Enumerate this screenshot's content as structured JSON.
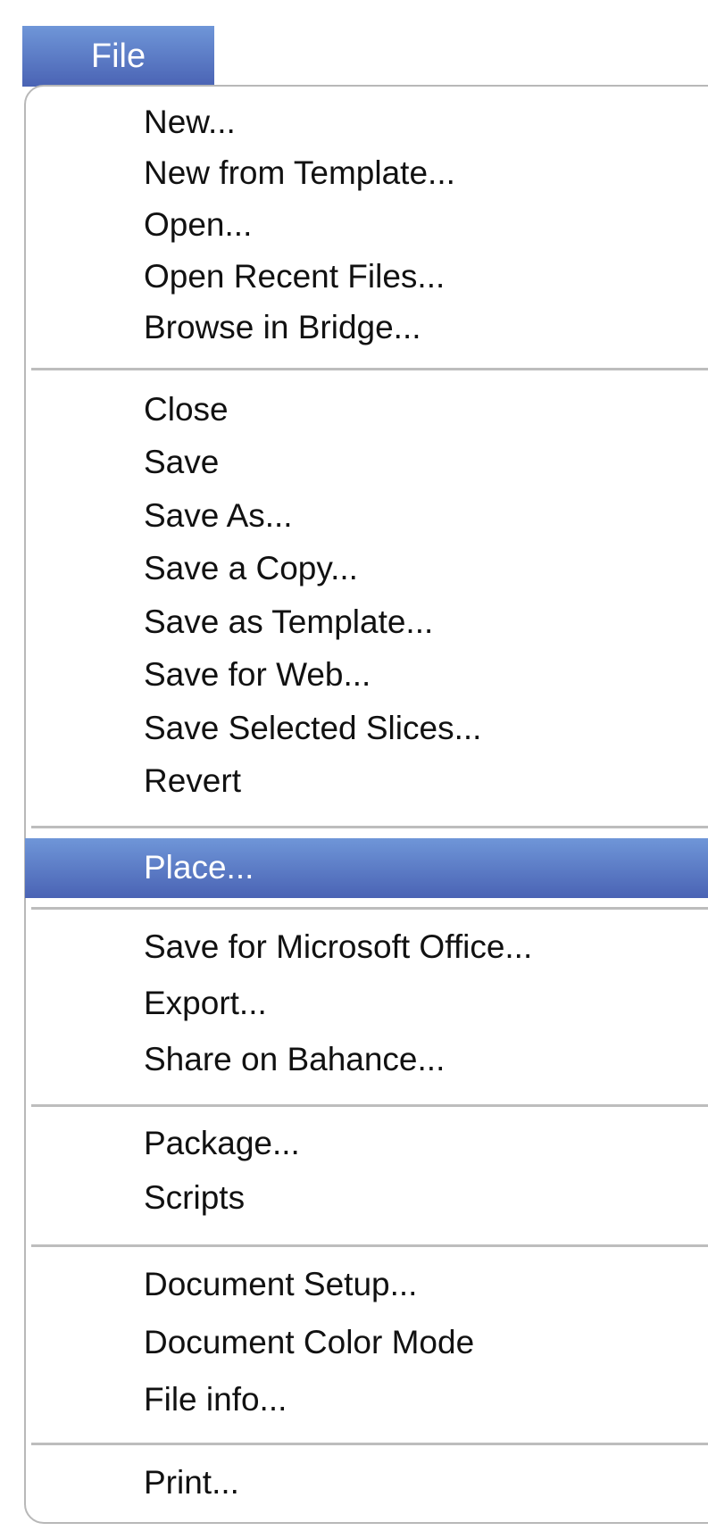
{
  "menu_bar": {
    "file_label": "File"
  },
  "menu": {
    "groups": [
      [
        "New...",
        "New from Template...",
        "Open...",
        "Open Recent Files...",
        "Browse in Bridge..."
      ],
      [
        "Close",
        "Save",
        "Save As...",
        "Save a Copy...",
        "Save as Template...",
        "Save for Web...",
        "Save Selected Slices...",
        "Revert"
      ],
      [
        "Place..."
      ],
      [
        "Save for Microsoft Office...",
        "Export...",
        "Share on Bahance..."
      ],
      [
        "Package...",
        "Scripts"
      ],
      [
        "Document Setup...",
        "Document Color Mode",
        "File info..."
      ],
      [
        "Print..."
      ]
    ],
    "highlighted_item": "Place..."
  },
  "colors": {
    "accent_top": "#6f96d8",
    "accent_bottom": "#4a63b4",
    "separator": "#bdbdbd",
    "border": "#b8b8b8"
  }
}
